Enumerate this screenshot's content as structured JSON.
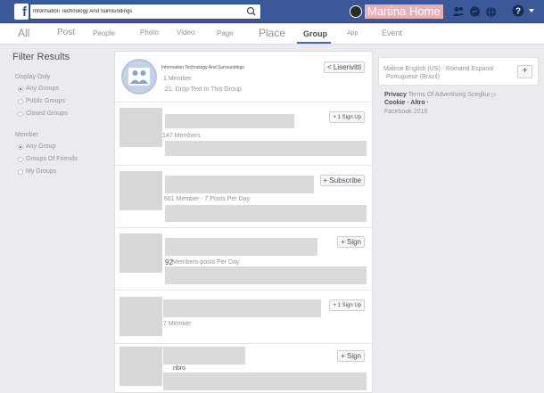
{
  "header": {
    "logo": "f",
    "search_value": "Information Technology And Surroundings",
    "profile_name": "Martina",
    "home_label": "Home"
  },
  "tabs": [
    "All",
    "Post",
    "People",
    "Photo",
    "Video",
    "Page",
    "Place",
    "Group",
    "App",
    "Event"
  ],
  "active_tab": "Group",
  "filter": {
    "title": "Filter Results",
    "display_label": "Display Only",
    "display_options": [
      "Any Groups",
      "Public Groups",
      "Closed Groups"
    ],
    "member_label": "Member",
    "member_options": [
      "Any Group",
      "Groups Of Friends",
      "My Groups"
    ]
  },
  "results": {
    "first": {
      "name": "Information Technology And Surroundings",
      "members": "1 Member",
      "description": "21. Drop Text In This Group",
      "button": "< Liserivitti"
    },
    "items": [
      {
        "meta": "147 Members",
        "button": "+ 1 Sign Up"
      },
      {
        "meta": "661 Member  ·  7 Posts Per Day",
        "button": "+ Subscribe"
      },
      {
        "meta_prefix": "92",
        "meta": "Members-posts Per Day",
        "button": "+ Sign"
      },
      {
        "meta": "7 Member",
        "button": "+ 1 Sign Up"
      },
      {
        "meta": "nbro",
        "button": "+ Sign"
      }
    ]
  },
  "sidebar": {
    "lang_line1": "Malese English (US) · Romand Espanol",
    "lang_line2": "Portuguese (Brazil)",
    "lang_add": "+",
    "footer_privacy": "Privacy",
    "footer_terms": "Terms Of Advertising Scegliur",
    "footer_cookie": "Cookie · Altro ·",
    "footer_copyright": "Facebook 2018"
  }
}
